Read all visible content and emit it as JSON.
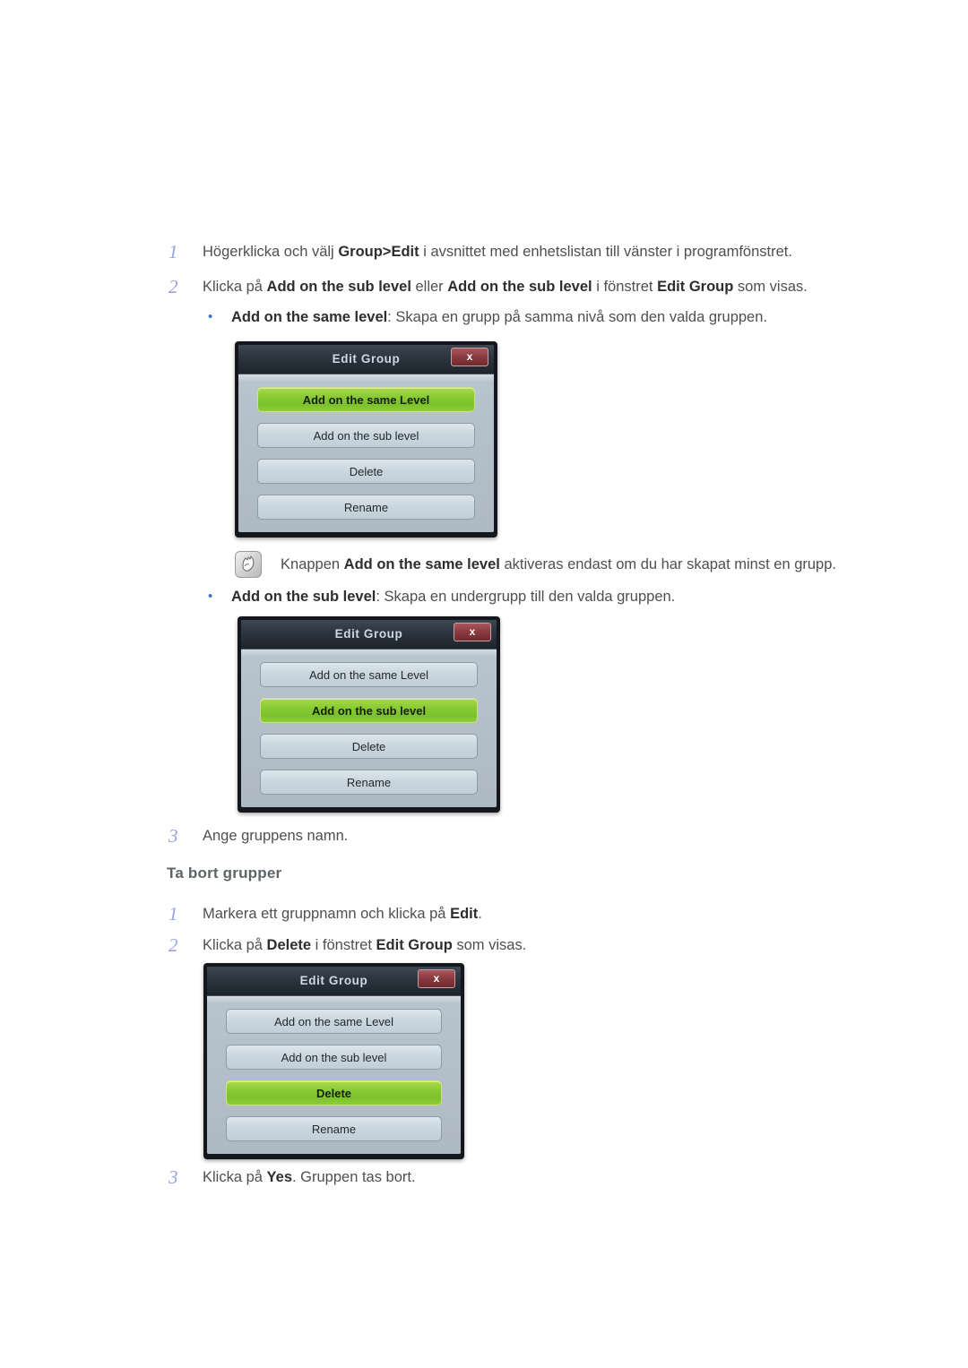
{
  "page": {
    "background": "#ffffff",
    "accent_step_number": "#97a3e6",
    "bullet_color": "#4472c4",
    "heading_color": "#5c6468",
    "active_button_green": "#86c933",
    "close_button_red": "#8d3b40",
    "titlebar_dark": "#2b333d"
  },
  "sections": {
    "create_group": {
      "steps": [
        {
          "number": "1",
          "parts": [
            {
              "text": "Högerklicka och välj ",
              "bold": false
            },
            {
              "text": "Group>Edit",
              "bold": true
            },
            {
              "text": " i avsnittet med enhetslistan till vänster i programfönstret.",
              "bold": false
            }
          ]
        },
        {
          "number": "2",
          "parts": [
            {
              "text": "Klicka på ",
              "bold": false
            },
            {
              "text": "Add on the sub level",
              "bold": true
            },
            {
              "text": " eller ",
              "bold": false
            },
            {
              "text": "Add on the sub level",
              "bold": true
            },
            {
              "text": " i fönstret ",
              "bold": false
            },
            {
              "text": "Edit Group",
              "bold": true
            },
            {
              "text": " som visas.",
              "bold": false
            }
          ]
        }
      ],
      "bullets": [
        {
          "parts": [
            {
              "text": "Add on the same level",
              "bold": true
            },
            {
              "text": ": Skapa en grupp på samma nivå som den valda gruppen.",
              "bold": false
            }
          ]
        },
        {
          "parts": [
            {
              "text": "Add on the sub level",
              "bold": true
            },
            {
              "text": ": Skapa en undergrupp till den valda gruppen.",
              "bold": false
            }
          ]
        }
      ],
      "note": {
        "icon": "note-pen-icon",
        "parts": [
          {
            "text": "Knappen ",
            "bold": false
          },
          {
            "text": "Add on the same level",
            "bold": true
          },
          {
            "text": " aktiveras endast om du har skapat minst en grupp.",
            "bold": false
          }
        ]
      },
      "final_step": {
        "number": "3",
        "parts": [
          {
            "text": "Ange gruppens namn.",
            "bold": false
          }
        ]
      }
    },
    "delete_group": {
      "heading": "Ta bort grupper",
      "steps": [
        {
          "number": "1",
          "parts": [
            {
              "text": "Markera ett gruppnamn och klicka på ",
              "bold": false
            },
            {
              "text": "Edit",
              "bold": true
            },
            {
              "text": ".",
              "bold": false
            }
          ]
        },
        {
          "number": "2",
          "parts": [
            {
              "text": "Klicka på ",
              "bold": false
            },
            {
              "text": "Delete",
              "bold": true
            },
            {
              "text": " i fönstret ",
              "bold": false
            },
            {
              "text": "Edit Group",
              "bold": true
            },
            {
              "text": " som visas.",
              "bold": false
            }
          ]
        }
      ],
      "final_step": {
        "number": "3",
        "parts": [
          {
            "text": "Klicka på ",
            "bold": false
          },
          {
            "text": "Yes",
            "bold": true
          },
          {
            "text": ". Gruppen tas bort.",
            "bold": false
          }
        ]
      }
    }
  },
  "dialogs": [
    {
      "id": "dialog-same-level",
      "title": "Edit Group",
      "close_label": "x",
      "buttons": [
        {
          "label": "Add on the same Level",
          "active": true
        },
        {
          "label": "Add on the sub level",
          "active": false
        },
        {
          "label": "Delete",
          "active": false
        },
        {
          "label": "Rename",
          "active": false
        }
      ]
    },
    {
      "id": "dialog-sub-level",
      "title": "Edit Group",
      "close_label": "x",
      "buttons": [
        {
          "label": "Add on the same Level",
          "active": false
        },
        {
          "label": "Add on the sub level",
          "active": true
        },
        {
          "label": "Delete",
          "active": false
        },
        {
          "label": "Rename",
          "active": false
        }
      ]
    },
    {
      "id": "dialog-delete",
      "title": "Edit Group",
      "close_label": "x",
      "buttons": [
        {
          "label": "Add on the same Level",
          "active": false
        },
        {
          "label": "Add on the sub level",
          "active": false
        },
        {
          "label": "Delete",
          "active": true
        },
        {
          "label": "Rename",
          "active": false
        }
      ]
    }
  ]
}
